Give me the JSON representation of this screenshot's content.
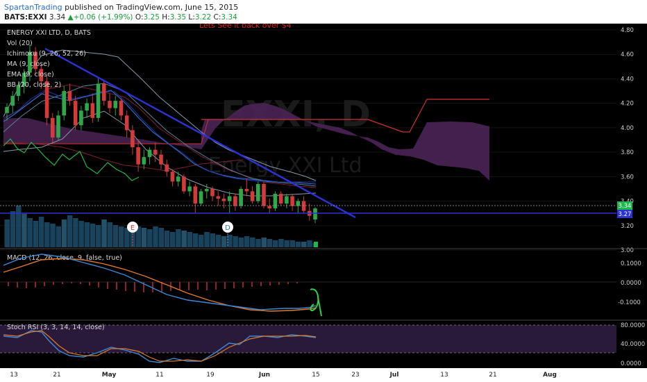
{
  "header": {
    "author": "SpartanTrading",
    "published": "published on TradingView.com, June 15, 2015",
    "symbol": "BATS:EXXI",
    "last": "3.34",
    "change": "+0.06 (+1.99%)",
    "open_label": "O:",
    "open": "3.25",
    "high_label": "H:",
    "high": "3.35",
    "low_label": "L:",
    "low": "3.22",
    "close_label": "C:",
    "close": "3.34"
  },
  "annotation": "Lets See it back over $4",
  "watermark": {
    "big": "EXXI, D",
    "small": "Energy XXI Ltd"
  },
  "indicators": [
    "ENERGY XXI LTD, D, BATS",
    "Vol (20)",
    "Ichimoku (9, 26, 52, 26)",
    "MA (9, close)",
    "EMA (9, close)",
    "BB (20, close, 2)"
  ],
  "markers": {
    "earnings": "E",
    "dividend": "D"
  },
  "price_badges": {
    "last": "3.34",
    "line": "3.27"
  },
  "panes": {
    "macd": {
      "label": "MACD (12, 26, close, 9, false, true)",
      "ticks": [
        "0.1000",
        "0.0000",
        "-0.1000"
      ]
    },
    "stoch": {
      "label": "Stoch RSI (3, 3, 14, 14, close)",
      "ticks": [
        "80.0000",
        "40.0000",
        "0.0000"
      ]
    }
  },
  "colors": {
    "background": "#000000",
    "up": "#2ea84a",
    "down": "#d33a3a",
    "trendline": "#2b33d6",
    "cloud": "#5a2a66"
  },
  "chart_data": {
    "type": "candlestick",
    "price_axis": {
      "ticks": [
        "4.80",
        "4.60",
        "4.40",
        "4.20",
        "4.00",
        "3.80",
        "3.60",
        "3.40",
        "3.20",
        "3.00"
      ],
      "range": [
        3.0,
        4.8
      ]
    },
    "x_ticks": [
      "13",
      "21",
      "May",
      "11",
      "19",
      "Jun",
      "15",
      "23",
      "Jul",
      "13",
      "21",
      "Aug"
    ],
    "candles": [
      {
        "o": 4.12,
        "h": 4.2,
        "l": 4.06,
        "c": 4.17
      },
      {
        "o": 4.18,
        "h": 4.3,
        "l": 4.12,
        "c": 4.26
      },
      {
        "o": 4.26,
        "h": 4.38,
        "l": 4.22,
        "c": 4.35
      },
      {
        "o": 4.34,
        "h": 4.48,
        "l": 4.28,
        "c": 4.45
      },
      {
        "o": 4.45,
        "h": 4.68,
        "l": 4.38,
        "c": 4.62
      },
      {
        "o": 4.62,
        "h": 4.66,
        "l": 4.44,
        "c": 4.48
      },
      {
        "o": 4.48,
        "h": 4.52,
        "l": 4.32,
        "c": 4.38
      },
      {
        "o": 4.38,
        "h": 4.42,
        "l": 4.02,
        "c": 4.08
      },
      {
        "o": 4.08,
        "h": 4.12,
        "l": 3.88,
        "c": 3.92
      },
      {
        "o": 3.92,
        "h": 4.14,
        "l": 3.9,
        "c": 4.1
      },
      {
        "o": 4.1,
        "h": 4.34,
        "l": 4.06,
        "c": 4.3
      },
      {
        "o": 4.3,
        "h": 4.36,
        "l": 4.18,
        "c": 4.22
      },
      {
        "o": 4.22,
        "h": 4.26,
        "l": 3.98,
        "c": 4.02
      },
      {
        "o": 4.02,
        "h": 4.18,
        "l": 3.98,
        "c": 4.14
      },
      {
        "o": 4.14,
        "h": 4.24,
        "l": 4.08,
        "c": 4.2
      },
      {
        "o": 4.2,
        "h": 4.28,
        "l": 4.04,
        "c": 4.08
      },
      {
        "o": 4.08,
        "h": 4.4,
        "l": 4.05,
        "c": 4.36
      },
      {
        "o": 4.36,
        "h": 4.38,
        "l": 4.18,
        "c": 4.22
      },
      {
        "o": 4.22,
        "h": 4.28,
        "l": 4.12,
        "c": 4.16
      },
      {
        "o": 4.16,
        "h": 4.26,
        "l": 4.1,
        "c": 4.22
      },
      {
        "o": 4.22,
        "h": 4.24,
        "l": 4.06,
        "c": 4.1
      },
      {
        "o": 4.1,
        "h": 4.14,
        "l": 3.92,
        "c": 3.98
      },
      {
        "o": 3.98,
        "h": 4.02,
        "l": 3.78,
        "c": 3.84
      },
      {
        "o": 3.84,
        "h": 3.9,
        "l": 3.64,
        "c": 3.7
      },
      {
        "o": 3.7,
        "h": 3.82,
        "l": 3.66,
        "c": 3.76
      },
      {
        "o": 3.76,
        "h": 3.84,
        "l": 3.7,
        "c": 3.82
      },
      {
        "o": 3.82,
        "h": 3.88,
        "l": 3.72,
        "c": 3.78
      },
      {
        "o": 3.78,
        "h": 3.82,
        "l": 3.66,
        "c": 3.7
      },
      {
        "o": 3.7,
        "h": 3.74,
        "l": 3.6,
        "c": 3.64
      },
      {
        "o": 3.64,
        "h": 3.66,
        "l": 3.52,
        "c": 3.56
      },
      {
        "o": 3.56,
        "h": 3.64,
        "l": 3.52,
        "c": 3.6
      },
      {
        "o": 3.6,
        "h": 3.62,
        "l": 3.46,
        "c": 3.48
      },
      {
        "o": 3.48,
        "h": 3.56,
        "l": 3.44,
        "c": 3.52
      },
      {
        "o": 3.52,
        "h": 3.54,
        "l": 3.3,
        "c": 3.38
      },
      {
        "o": 3.38,
        "h": 3.5,
        "l": 3.36,
        "c": 3.48
      },
      {
        "o": 3.48,
        "h": 3.54,
        "l": 3.42,
        "c": 3.5
      },
      {
        "o": 3.5,
        "h": 3.52,
        "l": 3.4,
        "c": 3.44
      },
      {
        "o": 3.44,
        "h": 3.48,
        "l": 3.36,
        "c": 3.42
      },
      {
        "o": 3.42,
        "h": 3.46,
        "l": 3.34,
        "c": 3.4
      },
      {
        "o": 3.4,
        "h": 3.48,
        "l": 3.3,
        "c": 3.44
      },
      {
        "o": 3.44,
        "h": 3.46,
        "l": 3.32,
        "c": 3.36
      },
      {
        "o": 3.36,
        "h": 3.52,
        "l": 3.34,
        "c": 3.5
      },
      {
        "o": 3.5,
        "h": 3.58,
        "l": 3.44,
        "c": 3.48
      },
      {
        "o": 3.48,
        "h": 3.52,
        "l": 3.38,
        "c": 3.4
      },
      {
        "o": 3.4,
        "h": 3.56,
        "l": 3.38,
        "c": 3.54
      },
      {
        "o": 3.54,
        "h": 3.56,
        "l": 3.34,
        "c": 3.36
      },
      {
        "o": 3.36,
        "h": 3.42,
        "l": 3.3,
        "c": 3.34
      },
      {
        "o": 3.34,
        "h": 3.48,
        "l": 3.32,
        "c": 3.46
      },
      {
        "o": 3.46,
        "h": 3.48,
        "l": 3.36,
        "c": 3.38
      },
      {
        "o": 3.38,
        "h": 3.46,
        "l": 3.34,
        "c": 3.44
      },
      {
        "o": 3.44,
        "h": 3.46,
        "l": 3.32,
        "c": 3.36
      },
      {
        "o": 3.36,
        "h": 3.42,
        "l": 3.3,
        "c": 3.4
      },
      {
        "o": 3.4,
        "h": 3.44,
        "l": 3.3,
        "c": 3.32
      },
      {
        "o": 3.32,
        "h": 3.38,
        "l": 3.24,
        "c": 3.28
      },
      {
        "o": 3.25,
        "h": 3.35,
        "l": 3.22,
        "c": 3.34
      }
    ]
  }
}
